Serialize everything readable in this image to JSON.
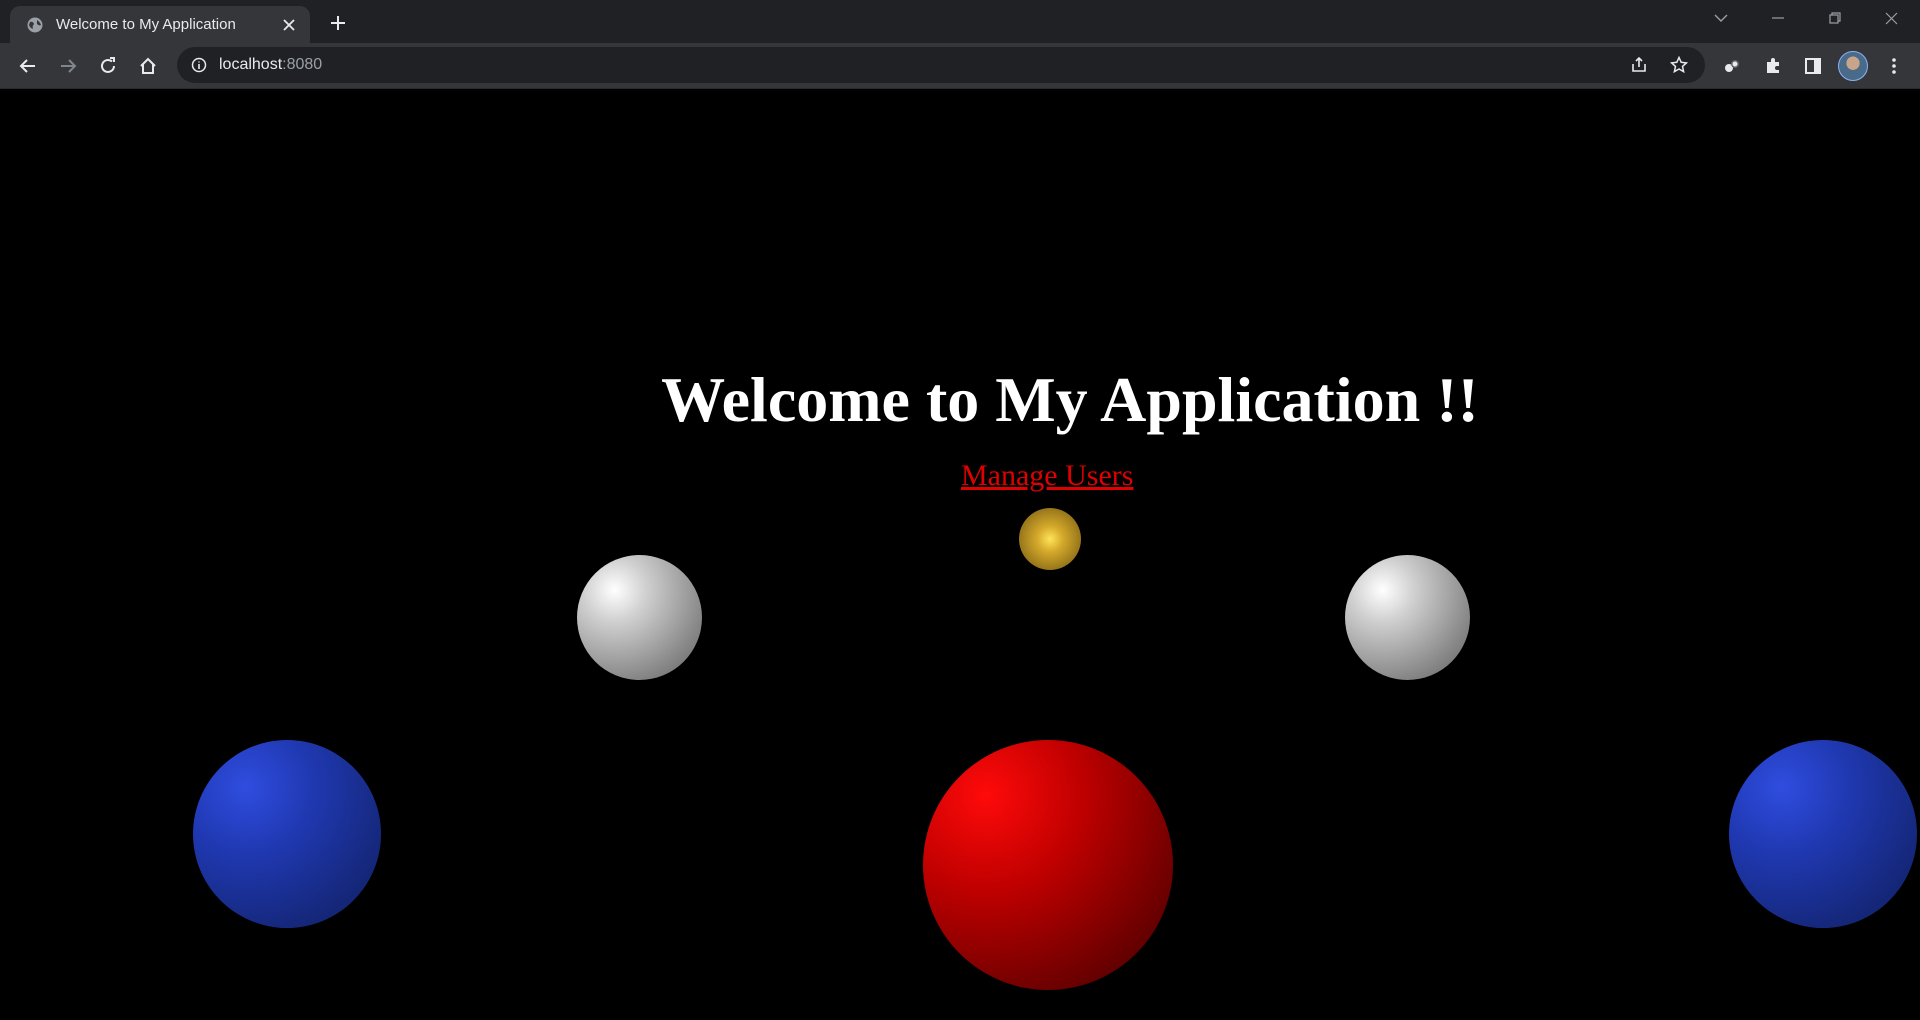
{
  "browser": {
    "tab_title": "Welcome to My Application",
    "url_host": "localhost",
    "url_port": ":8080"
  },
  "page": {
    "heading": "Welcome to My Application !!",
    "link_label": "Manage Users"
  },
  "colors": {
    "page_background": "#000000",
    "heading": "#ffffff",
    "link": "#e00000",
    "gold_ball": "#d4a82a",
    "silver_ball": "#d0d0d0",
    "blue_ball": "#1f38b0",
    "red_ball": "#c00000"
  },
  "icons": {
    "tab_favicon": "globe-icon",
    "tab_close": "close-icon",
    "new_tab": "plus-icon",
    "back": "back-arrow-icon",
    "forward": "forward-arrow-icon",
    "reload": "reload-icon",
    "home": "home-icon",
    "site_info": "info-icon",
    "share": "share-icon",
    "bookmark": "star-icon",
    "extension": "puzzle-icon",
    "side_panel": "side-panel-icon",
    "menu": "kebab-menu-icon"
  }
}
